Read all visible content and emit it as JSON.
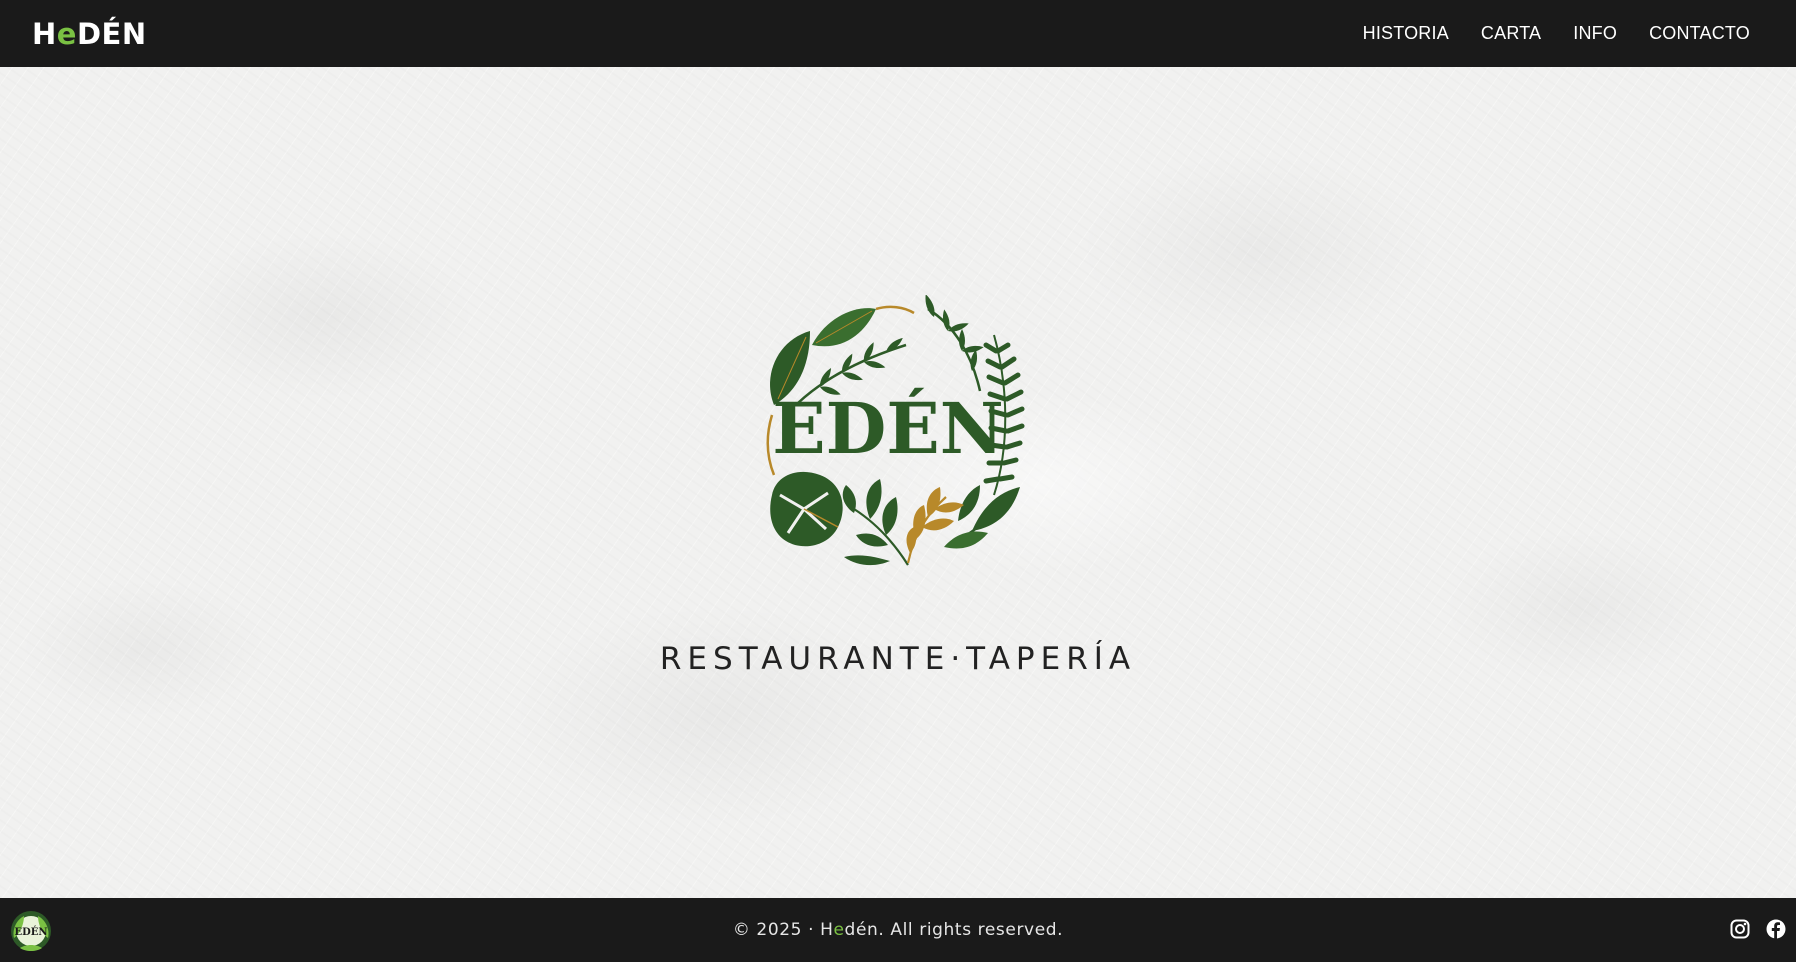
{
  "header": {
    "brand": {
      "first": "H",
      "accent": "e",
      "rest": "DÉN"
    },
    "nav": [
      {
        "label": "HISTORIA"
      },
      {
        "label": "CARTA"
      },
      {
        "label": "INFO"
      },
      {
        "label": "CONTACTO"
      }
    ]
  },
  "hero": {
    "logo_text": "EDÉN",
    "tagline": "RESTAURANTE·TAPERÍA"
  },
  "footer": {
    "copyright_prefix": "© 2025 · H",
    "copyright_accent": "e",
    "copyright_suffix": "dén. All rights reserved.",
    "footer_logo_text": "EDÉN",
    "socials": [
      {
        "icon": "instagram-icon"
      },
      {
        "icon": "facebook-icon"
      }
    ]
  },
  "colors": {
    "bar_background": "#1a1a1a",
    "accent_green": "#7ac143",
    "logo_green": "#2d5a27",
    "logo_gold": "#b8892a",
    "hero_background": "#f1f1f0"
  }
}
